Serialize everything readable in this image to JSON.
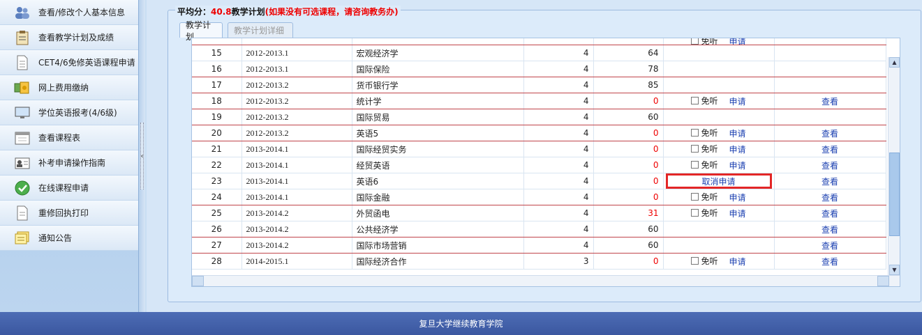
{
  "sidebar": {
    "items": [
      {
        "label": "查看/修改个人基本信息",
        "icon": "user-group-icon"
      },
      {
        "label": "查看教学计划及成绩",
        "icon": "clipboard-icon"
      },
      {
        "label": "CET4/6免修英语课程申请",
        "icon": "document-icon"
      },
      {
        "label": "网上费用缴纳",
        "icon": "money-icon"
      },
      {
        "label": "学位英语报考(4/6级)",
        "icon": "monitor-icon"
      },
      {
        "label": "查看课程表",
        "icon": "calendar-icon"
      },
      {
        "label": "补考申请操作指南",
        "icon": "id-card-icon"
      },
      {
        "label": "在线课程申请",
        "icon": "check-circle-icon"
      },
      {
        "label": "重修回执打印",
        "icon": "printer-icon"
      },
      {
        "label": "通知公告",
        "icon": "notes-icon"
      }
    ]
  },
  "splitter": {
    "arrow": "‹"
  },
  "panel": {
    "avg_label": "平均分：",
    "avg_value": "40.8",
    "title": "教学计划",
    "note": "(如果没有可选课程，请咨询教务办)"
  },
  "tabs": [
    {
      "label": "教学计划",
      "active": true
    },
    {
      "label": "教学计划详细",
      "active": false
    }
  ],
  "table": {
    "top_partial": {
      "exempt": "免听",
      "apply": "申请"
    },
    "rows": [
      {
        "no": "15",
        "term": "2012-2013.1",
        "course": "宏观经济学",
        "credit": "4",
        "score": "64",
        "action": "",
        "view": "",
        "sep": false
      },
      {
        "no": "16",
        "term": "2012-2013.1",
        "course": "国际保险",
        "credit": "4",
        "score": "78",
        "action": "",
        "view": "",
        "sep": true
      },
      {
        "no": "17",
        "term": "2012-2013.2",
        "course": "货币银行学",
        "credit": "4",
        "score": "85",
        "action": "",
        "view": "",
        "sep": true
      },
      {
        "no": "18",
        "term": "2012-2013.2",
        "course": "统计学",
        "credit": "4",
        "score": "0",
        "action": "apply",
        "view": "查看",
        "sep": true
      },
      {
        "no": "19",
        "term": "2012-2013.2",
        "course": "国际贸易",
        "credit": "4",
        "score": "60",
        "action": "",
        "view": "",
        "sep": true
      },
      {
        "no": "20",
        "term": "2012-2013.2",
        "course": "英语5",
        "credit": "4",
        "score": "0",
        "action": "apply",
        "view": "查看",
        "sep": true
      },
      {
        "no": "21",
        "term": "2013-2014.1",
        "course": "国际经贸实务",
        "credit": "4",
        "score": "0",
        "action": "apply",
        "view": "查看",
        "sep": false
      },
      {
        "no": "22",
        "term": "2013-2014.1",
        "course": "经贸英语",
        "credit": "4",
        "score": "0",
        "action": "apply",
        "view": "查看",
        "sep": false
      },
      {
        "no": "23",
        "term": "2013-2014.1",
        "course": "英语6",
        "credit": "4",
        "score": "0",
        "action": "cancel",
        "view": "查看",
        "sep": false
      },
      {
        "no": "24",
        "term": "2013-2014.1",
        "course": "国际金融",
        "credit": "4",
        "score": "0",
        "action": "apply",
        "view": "查看",
        "sep": true
      },
      {
        "no": "25",
        "term": "2013-2014.2",
        "course": "外贸函电",
        "credit": "4",
        "score": "31",
        "action": "apply",
        "view": "查看",
        "sep": false
      },
      {
        "no": "26",
        "term": "2013-2014.2",
        "course": "公共经济学",
        "credit": "4",
        "score": "60",
        "action": "",
        "view": "查看",
        "sep": true
      },
      {
        "no": "27",
        "term": "2013-2014.2",
        "course": "国际市场营销",
        "credit": "4",
        "score": "60",
        "action": "",
        "view": "查看",
        "sep": true
      },
      {
        "no": "28",
        "term": "2014-2015.1",
        "course": "国际经济合作",
        "credit": "3",
        "score": "0",
        "action": "apply",
        "view": "查看",
        "sep": false
      }
    ],
    "exempt_label": "免听",
    "apply_label": "申请",
    "cancel_label": "取消申请"
  },
  "footer": {
    "text": "复旦大学继续教育学院"
  },
  "colors": {
    "accent_red": "#e00000",
    "link_blue": "#1a3fb0",
    "footer_blue": "#3b57a0"
  }
}
